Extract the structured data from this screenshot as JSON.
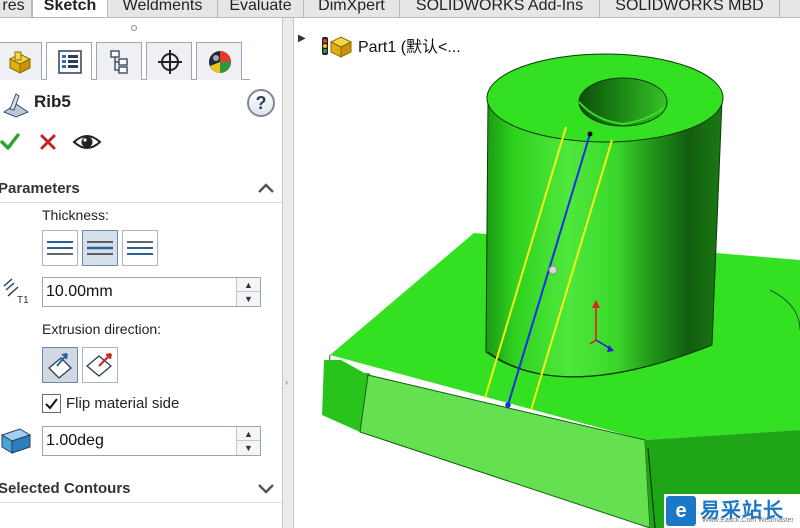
{
  "tabs": [
    "res",
    "Sketch",
    "Weldments",
    "Evaluate",
    "DimXpert",
    "SOLIDWORKS Add-Ins",
    "SOLIDWORKS MBD"
  ],
  "active_tab": "Sketch",
  "pane_tabs": [
    "feature-manager-icon",
    "property-manager-icon",
    "configuration-manager-icon",
    "dimxpert-manager-icon",
    "display-manager-icon"
  ],
  "feature": {
    "title": "Rib5",
    "help_label": "?"
  },
  "parameters": {
    "header": "Parameters",
    "thickness_label": "Thickness:",
    "thickness_value": "10.00mm",
    "thickness_icon_text": "T1",
    "extrusion_label": "Extrusion direction:",
    "flip_label": "Flip material side",
    "flip_checked": true,
    "draft_value": "1.00deg"
  },
  "selected_contours": {
    "header": "Selected Contours"
  },
  "tree": {
    "part_label": "Part1  (默认<..."
  },
  "watermark": {
    "logo": "e",
    "text": "易采站长站",
    "url": "Www.Easck.Com  Webmaster"
  },
  "colors": {
    "part_green": "#33e022",
    "sketch_yellow": "#f2f21a",
    "sketch_blue": "#1a2ee8",
    "accept_green": "#2aa52a",
    "cancel_red": "#cc2020"
  }
}
